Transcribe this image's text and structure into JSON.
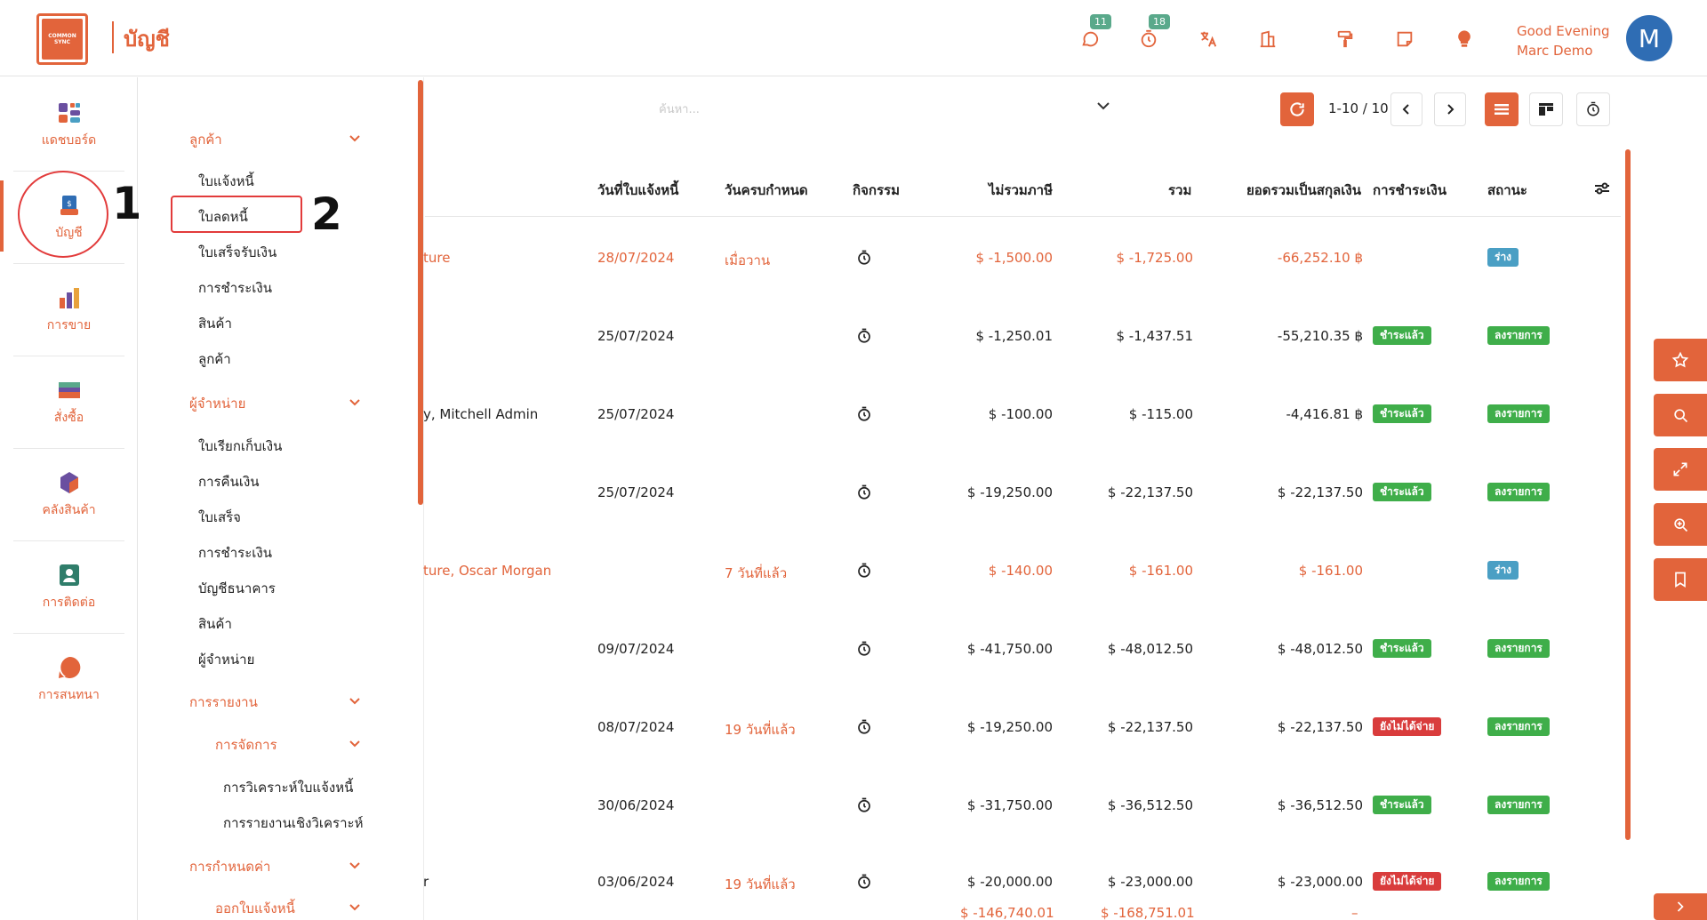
{
  "app": {
    "logo_text": "COMMON SYNC",
    "title": "บัญชี"
  },
  "topbar": {
    "icons": [
      {
        "name": "chat-icon",
        "badge": "11"
      },
      {
        "name": "timer-icon",
        "badge": "18"
      },
      {
        "name": "translate-icon",
        "badge": ""
      },
      {
        "name": "company-icon",
        "badge": ""
      },
      {
        "name": "paint-roller-icon",
        "badge": ""
      },
      {
        "name": "note-icon",
        "badge": ""
      },
      {
        "name": "lightbulb-icon",
        "badge": ""
      }
    ],
    "greeting": "Good Evening",
    "user_name": "Marc Demo",
    "avatar_letter": "M"
  },
  "rail": {
    "items": [
      {
        "label": "แดชบอร์ด",
        "icon": "dashboard-icon"
      },
      {
        "label": "บัญชี",
        "icon": "accounting-icon"
      },
      {
        "label": "การขาย",
        "icon": "sales-icon"
      },
      {
        "label": "สั่งซื้อ",
        "icon": "purchase-icon"
      },
      {
        "label": "คลังสินค้า",
        "icon": "inventory-icon"
      },
      {
        "label": "การติดต่อ",
        "icon": "contacts-icon"
      },
      {
        "label": "การสนทนา",
        "icon": "discuss-icon"
      }
    ]
  },
  "annotations": {
    "one": "1",
    "two": "2"
  },
  "submenu": {
    "customers": {
      "title": "ลูกค้า",
      "items": [
        "ใบแจ้งหนี้",
        "ใบลดหนี้",
        "ใบเสร็จรับเงิน",
        "การชำระเงิน",
        "สินค้า",
        "ลูกค้า"
      ]
    },
    "vendors": {
      "title": "ผู้จำหน่าย",
      "items": [
        "ใบเรียกเก็บเงิน",
        "การคืนเงิน",
        "ใบเสร็จ",
        "การชำระเงิน",
        "บัญชีธนาคาร",
        "สินค้า",
        "ผู้จำหน่าย"
      ]
    },
    "reporting": {
      "title": "การรายงาน"
    },
    "management": {
      "title": "การจัดการ",
      "items": [
        "การวิเคราะห์ใบแจ้งหนี้",
        "การรายงานเชิงวิเคราะห์"
      ]
    },
    "configuration": {
      "title": "การกำหนดค่า"
    },
    "invoicing": {
      "title": "ออกใบแจ้งหนี้"
    }
  },
  "search": {
    "placeholder": "ค้นหา..."
  },
  "pager": {
    "text": "1-10 / 10"
  },
  "table": {
    "headers": {
      "invoice_date": "วันที่ใบแจ้งหนี้",
      "due_date": "วันครบกำหนด",
      "activity": "กิจกรรม",
      "untaxed": "ไม่รวมภาษี",
      "total": "รวม",
      "total_currency": "ยอดรวมเป็นสกุลเงิน",
      "payment": "การชำระเงิน",
      "status": "สถานะ"
    },
    "rows": [
      {
        "partner": "ture",
        "invoice_date": "28/07/2024",
        "due_date": "เมื่อวาน",
        "untaxed": "$ -1,500.00",
        "total": "$ -1,725.00",
        "total_currency": "-66,252.10 ฿",
        "payment": "",
        "status": "ร่าง",
        "highlight": true
      },
      {
        "partner": "",
        "invoice_date": "25/07/2024",
        "due_date": "",
        "untaxed": "$ -1,250.01",
        "total": "$ -1,437.51",
        "total_currency": "-55,210.35 ฿",
        "payment": "ชำระแล้ว",
        "status": "ลงรายการ",
        "highlight": false
      },
      {
        "partner": "y, Mitchell Admin",
        "invoice_date": "25/07/2024",
        "due_date": "",
        "untaxed": "$ -100.00",
        "total": "$ -115.00",
        "total_currency": "-4,416.81 ฿",
        "payment": "ชำระแล้ว",
        "status": "ลงรายการ",
        "highlight": false
      },
      {
        "partner": "",
        "invoice_date": "25/07/2024",
        "due_date": "",
        "untaxed": "$ -19,250.00",
        "total": "$ -22,137.50",
        "total_currency": "$ -22,137.50",
        "payment": "ชำระแล้ว",
        "status": "ลงรายการ",
        "highlight": false
      },
      {
        "partner": "ture, Oscar Morgan",
        "invoice_date": "",
        "due_date": "7 วันที่แล้ว",
        "untaxed": "$ -140.00",
        "total": "$ -161.00",
        "total_currency": "$ -161.00",
        "payment": "",
        "status": "ร่าง",
        "highlight": true
      },
      {
        "partner": "",
        "invoice_date": "09/07/2024",
        "due_date": "",
        "untaxed": "$ -41,750.00",
        "total": "$ -48,012.50",
        "total_currency": "$ -48,012.50",
        "payment": "ชำระแล้ว",
        "status": "ลงรายการ",
        "highlight": false
      },
      {
        "partner": "",
        "invoice_date": "08/07/2024",
        "due_date": "19 วันที่แล้ว",
        "untaxed": "$ -19,250.00",
        "total": "$ -22,137.50",
        "total_currency": "$ -22,137.50",
        "payment": "ยังไม่ได้จ่าย",
        "status": "ลงรายการ",
        "highlight": false
      },
      {
        "partner": "",
        "invoice_date": "30/06/2024",
        "due_date": "",
        "untaxed": "$ -31,750.00",
        "total": "$ -36,512.50",
        "total_currency": "$ -36,512.50",
        "payment": "ชำระแล้ว",
        "status": "ลงรายการ",
        "highlight": false
      },
      {
        "partner": "r",
        "invoice_date": "03/06/2024",
        "due_date": "19 วันที่แล้ว",
        "untaxed": "$ -20,000.00",
        "total": "$ -23,000.00",
        "total_currency": "$ -23,000.00",
        "payment": "ยังไม่ได้จ่าย",
        "status": "ลงรายการ",
        "highlight": false
      }
    ],
    "totals": {
      "untaxed": "$ -146,740.01",
      "total": "$ -168,751.01",
      "total_currency": "–"
    }
  },
  "colors": {
    "accent": "#e2643b",
    "paid": "#3fae4a",
    "unpaid": "#d93c3c",
    "draft": "#4a9fc4"
  }
}
